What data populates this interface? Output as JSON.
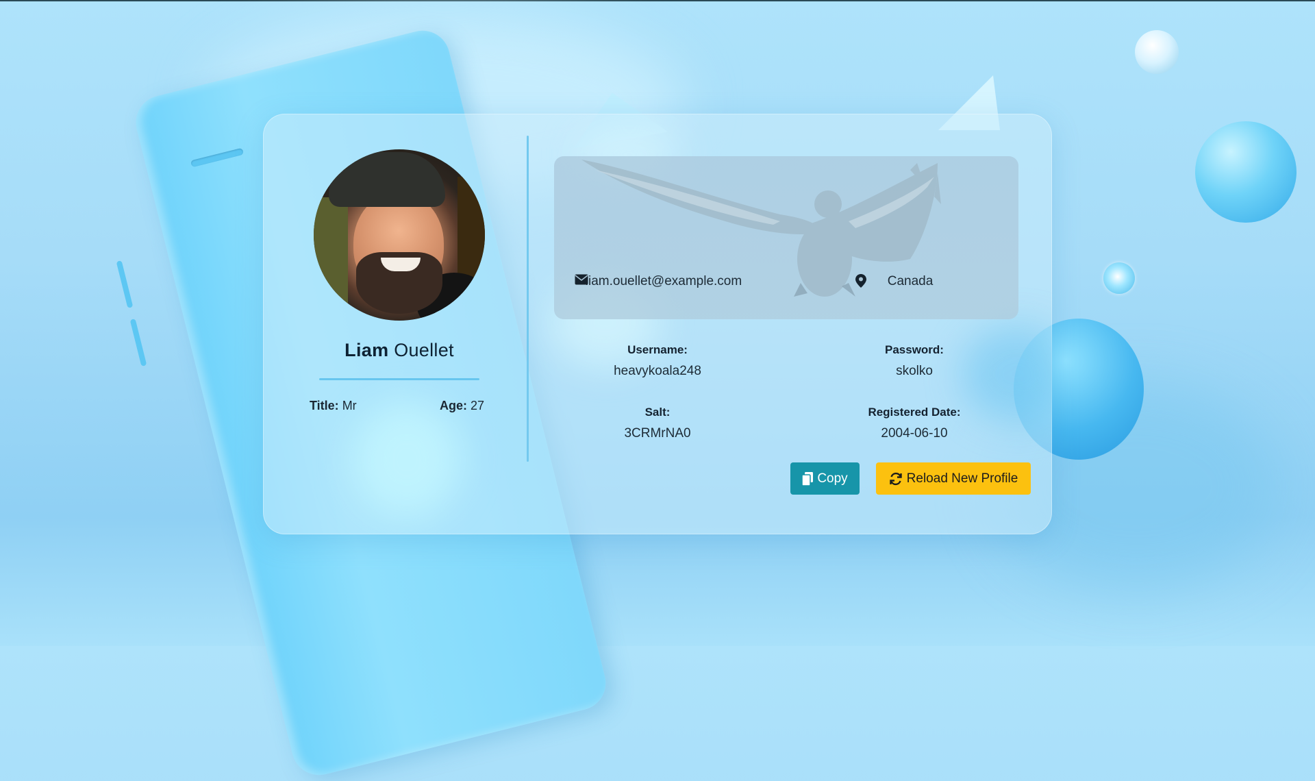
{
  "profile": {
    "first_name": "Liam",
    "last_name": "Ouellet",
    "title_label": "Title:",
    "title_value": "Mr",
    "age_label": "Age:",
    "age_value": "27",
    "email": "liam.ouellet@example.com",
    "location": "Canada",
    "username_label": "Username:",
    "username_value": "heavykoala248",
    "password_label": "Password:",
    "password_value": "skolko",
    "salt_label": "Salt:",
    "salt_value": "3CRMrNA0",
    "registered_label": "Registered Date:",
    "registered_value": "2004-06-10"
  },
  "actions": {
    "copy_label": "Copy",
    "reload_label": "Reload New Profile"
  },
  "icons": {
    "email": "envelope-icon",
    "location": "map-marker-icon",
    "copy": "copy-icon",
    "reload": "refresh-icon"
  },
  "colors": {
    "copy_button": "#1795a9",
    "reload_button": "#fcc10f",
    "divider": "#73c9ef"
  }
}
